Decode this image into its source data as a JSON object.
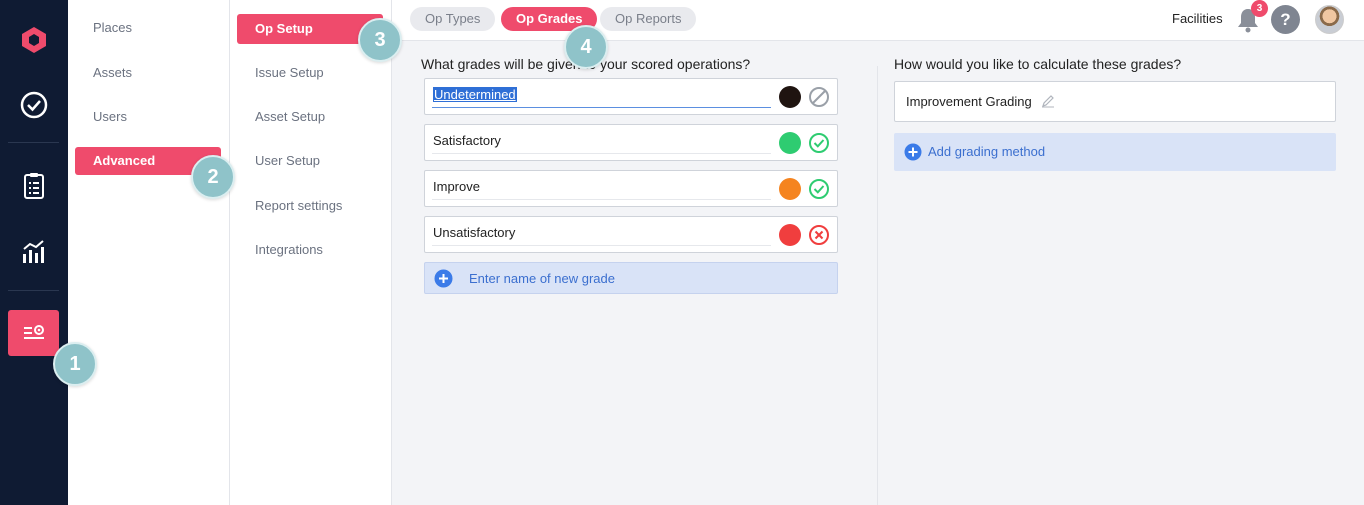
{
  "rail": {
    "items": [
      {
        "icon": "logo-hexagon-icon"
      },
      {
        "icon": "check-circle-icon"
      },
      {
        "icon": "clipboard-checklist-icon"
      },
      {
        "icon": "analytics-chart-icon"
      },
      {
        "icon": "settings-sliders-icon",
        "active": true
      }
    ],
    "accent_color": "#ef4b6c"
  },
  "nav1": {
    "items": [
      {
        "label": "Places"
      },
      {
        "label": "Assets"
      },
      {
        "label": "Users"
      },
      {
        "label": "Advanced",
        "active": true
      }
    ]
  },
  "nav2": {
    "items": [
      {
        "label": "Op Setup",
        "active": true
      },
      {
        "label": "Issue Setup"
      },
      {
        "label": "Asset Setup"
      },
      {
        "label": "User Setup"
      },
      {
        "label": "Report settings"
      },
      {
        "label": "Integrations"
      }
    ]
  },
  "tabs": [
    {
      "label": "Op Types"
    },
    {
      "label": "Op Grades",
      "active": true
    },
    {
      "label": "Op Reports"
    }
  ],
  "header": {
    "facilities": "Facilities",
    "notification_count": "3",
    "help": "?"
  },
  "grades": {
    "question": "What grades will be given to your scored operations?",
    "items": [
      {
        "name": "Undetermined",
        "color": "#1f1410",
        "status": "not-applicable-icon",
        "selected": true
      },
      {
        "name": "Satisfactory",
        "color": "#2ecc71",
        "status": "pass-check-icon"
      },
      {
        "name": "Improve",
        "color": "#f5841f",
        "status": "pass-check-icon"
      },
      {
        "name": "Unsatisfactory",
        "color": "#f03e3e",
        "status": "fail-x-icon"
      }
    ],
    "new_placeholder": "Enter name of new grade"
  },
  "calculation": {
    "question": "How would you like to calculate these grades?",
    "method": "Improvement Grading",
    "add_label": "Add grading method"
  },
  "markers": [
    "1",
    "2",
    "3",
    "4"
  ]
}
